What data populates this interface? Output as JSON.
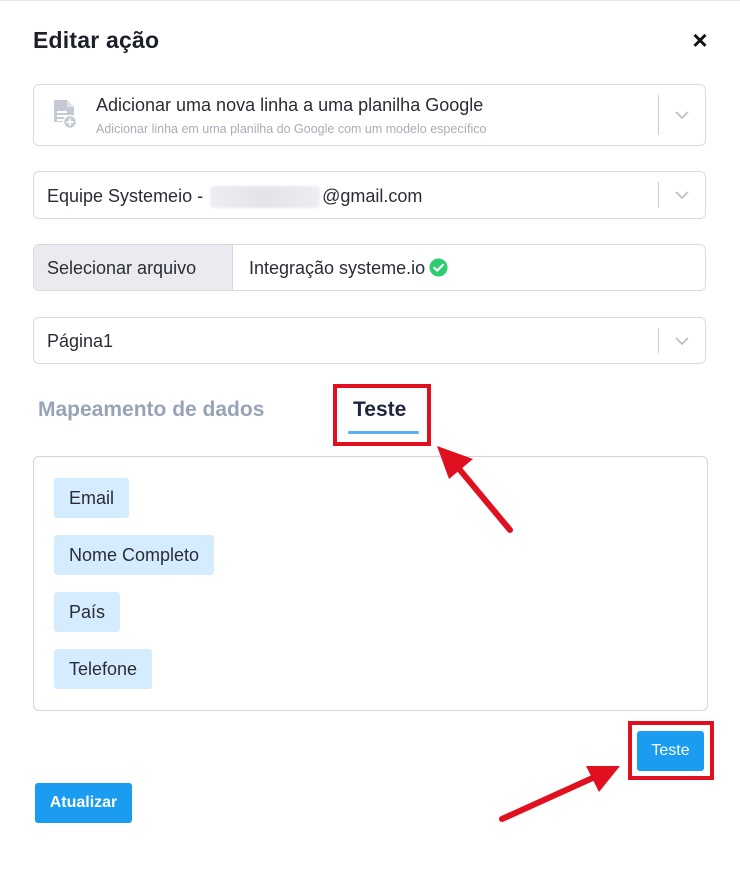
{
  "modal": {
    "title": "Editar ação",
    "close_label": "×"
  },
  "action_select": {
    "label": "Adicionar uma nova linha a uma planilha Google",
    "description": "Adicionar linha em uma planilha do Google com um modelo específico",
    "icon": "add-row-document-icon"
  },
  "account_select": {
    "prefix": "Equipe Systemeio - ",
    "suffix": "@gmail.com"
  },
  "file": {
    "button_label": "Selecionar arquivo",
    "selected_name": "Integração systeme.io",
    "status_icon": "check-circle-icon",
    "status_color": "#2ecc71"
  },
  "sheet_select": {
    "value": "Página1"
  },
  "tabs": [
    {
      "label": "Mapeamento de dados",
      "active": false
    },
    {
      "label": "Teste",
      "active": true
    }
  ],
  "fields": [
    "Email",
    "Nome Completo",
    "País",
    "Telefone"
  ],
  "buttons": {
    "test": "Teste",
    "update": "Atualizar"
  },
  "colors": {
    "primary": "#1a9cf0",
    "chip_bg": "#d4ecfe",
    "highlight": "#e01020",
    "tab_inactive": "#98a3b7",
    "tab_active": "#1f2440"
  }
}
